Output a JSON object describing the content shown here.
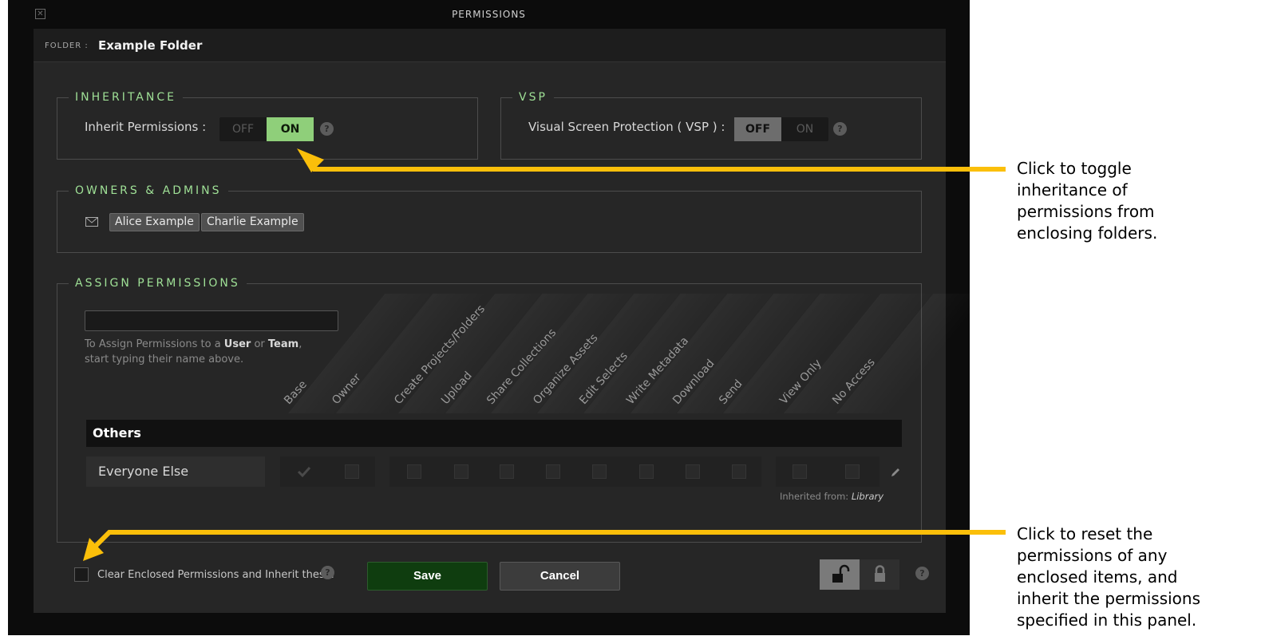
{
  "window": {
    "title": "PERMISSIONS",
    "close_icon": "close-icon"
  },
  "folder": {
    "label": "FOLDER :",
    "name": "Example Folder"
  },
  "inheritance": {
    "legend": "INHERITANCE",
    "label": "Inherit Permissions :",
    "off": "OFF",
    "on": "ON",
    "state": "ON",
    "help": "?"
  },
  "vsp": {
    "legend": "VSP",
    "label": "Visual Screen Protection ( VSP ) :",
    "off": "OFF",
    "on": "ON",
    "state": "OFF",
    "help": "?"
  },
  "owners": {
    "legend": "OWNERS & ADMINS",
    "icon": "mail-icon",
    "people": [
      "Alice Example",
      "Charlie Example"
    ]
  },
  "assign": {
    "legend": "ASSIGN PERMISSIONS",
    "input_value": "",
    "hint_1": "To Assign Permissions to a ",
    "hint_user": "User",
    "hint_or": " or ",
    "hint_team": "Team",
    "hint_comma": ",",
    "hint_2": "start typing their name above.",
    "columns": [
      "Base",
      "Owner",
      "Create Projects/Folders",
      "Upload",
      "Share Collections",
      "Organize Assets",
      "Edit Selects",
      "Write Metadata",
      "Download",
      "Send",
      "View Only",
      "No Access"
    ]
  },
  "others": {
    "group_label": "Others",
    "row_name": "Everyone Else",
    "checked": [
      true,
      false,
      false,
      false,
      false,
      false,
      false,
      false,
      false,
      false,
      false,
      false
    ],
    "inherited_prefix": "Inherited from: ",
    "inherited_source": "Library",
    "edit_icon": "pencil-icon"
  },
  "footer": {
    "clear_label": "Clear Enclosed Permissions and Inherit these.",
    "clear_checked": false,
    "help": "?",
    "save": "Save",
    "cancel": "Cancel",
    "lock_state": "unlocked"
  },
  "annotations": {
    "toggle": [
      "Click to toggle",
      "inheritance of",
      "permissions from",
      "enclosing folders."
    ],
    "reset": [
      "Click to reset the",
      "permissions of any",
      "enclosed items, and",
      "inherit the permissions",
      "specified in this panel."
    ],
    "arrow_color": "#fbbf0a"
  },
  "colors": {
    "accent_green": "#9fe096",
    "toggle_on_green": "#8fcf7a",
    "save_green": "#0f3d0f"
  }
}
